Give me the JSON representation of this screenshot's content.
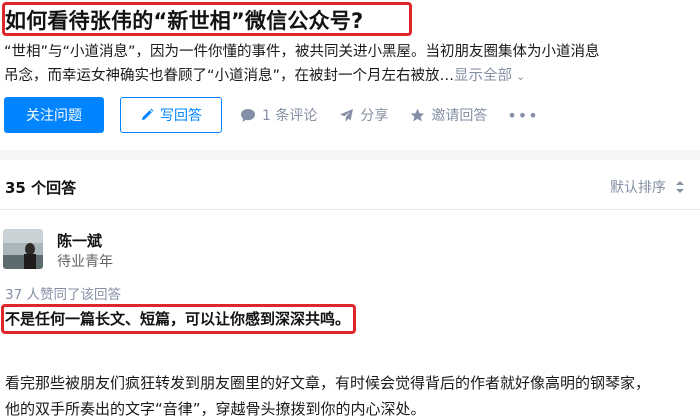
{
  "question": {
    "title": "如何看待张伟的“新世相”微信公众号?",
    "detail_line1": "“世相”与“小道消息”，因为一件你懂的事件，被共同关进小黑屋。当初朋友圈集体为小道消息",
    "detail_line2": "吊念，而幸运女神确实也眷顾了“小道消息”，在被封一个月左右被放…",
    "show_all": "显示全部"
  },
  "actions": {
    "follow": "关注问题",
    "write": "写回答",
    "comments": "1 条评论",
    "share": "分享",
    "invite": "邀请回答",
    "more": "•••"
  },
  "list": {
    "count": "35 个回答",
    "sort": "默认排序"
  },
  "answer": {
    "author": "陈一斌",
    "headline": "待业青年",
    "votes": "37 人赞同了该回答",
    "highlight": "不是任何一篇长文、短篇，可以让你感到深深共鸣。",
    "body_line1": "看完那些被朋友们疯狂转发到朋友圈里的好文章，有时候会觉得背后的作者就好像高明的钢琴家，",
    "body_line2": "他的双手所奏出的文字“音律”，穿越骨头撩拨到你的内心深处。"
  },
  "colors": {
    "accent": "#0084ff",
    "annotation": "#e0262b",
    "meta": "#8590a6"
  },
  "icons": {
    "write": "pencil-icon",
    "comment": "comment-bubble-icon",
    "share": "paper-plane-icon",
    "invite": "star-icon",
    "sort": "sort-arrows-icon",
    "show_all": "chevron-down-icon"
  }
}
